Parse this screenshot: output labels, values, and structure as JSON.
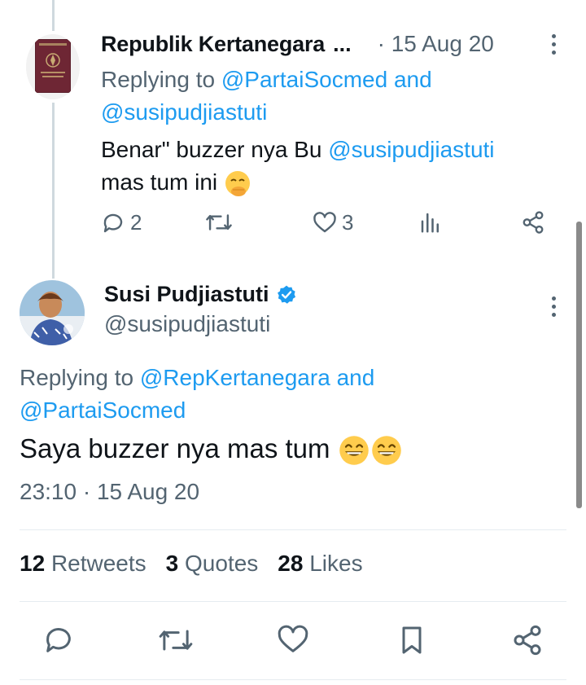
{
  "reply_tweet": {
    "author_name": "Republik Kertanegara",
    "name_truncation": "...",
    "date": "· 15 Aug 20",
    "replying_prefix": "Replying to",
    "replying_mention_1": "@PartaiSocmed",
    "replying_and": "and",
    "replying_mention_2": "@susipudjiastuti",
    "text_part_1": "Benar\" buzzer nya Bu",
    "text_mention": "@susipudjiastuti",
    "text_part_2": "mas tum ini",
    "text_emoji": "face-with-hand-over-mouth-emoji",
    "reply_count": "2",
    "like_count": "3"
  },
  "main_tweet": {
    "author_name": "Susi Pudjiastuti",
    "handle": "@susipudjiastuti",
    "replying_prefix": "Replying to",
    "replying_mention_1": "@RepKertanegara",
    "replying_and": "and",
    "replying_mention_2": "@PartaiSocmed",
    "text": "Saya buzzer nya mas tum",
    "text_emoji": "grinning-face-with-smiling-eyes-emoji",
    "timestamp": "23:10 · 15 Aug 20"
  },
  "stats": {
    "retweets_count": "12",
    "retweets_label": "Retweets",
    "quotes_count": "3",
    "quotes_label": "Quotes",
    "likes_count": "28",
    "likes_label": "Likes"
  },
  "colors": {
    "link": "#1d9bf0",
    "muted": "#536471",
    "text": "#0f1419",
    "verified": "#1d9bf0"
  }
}
